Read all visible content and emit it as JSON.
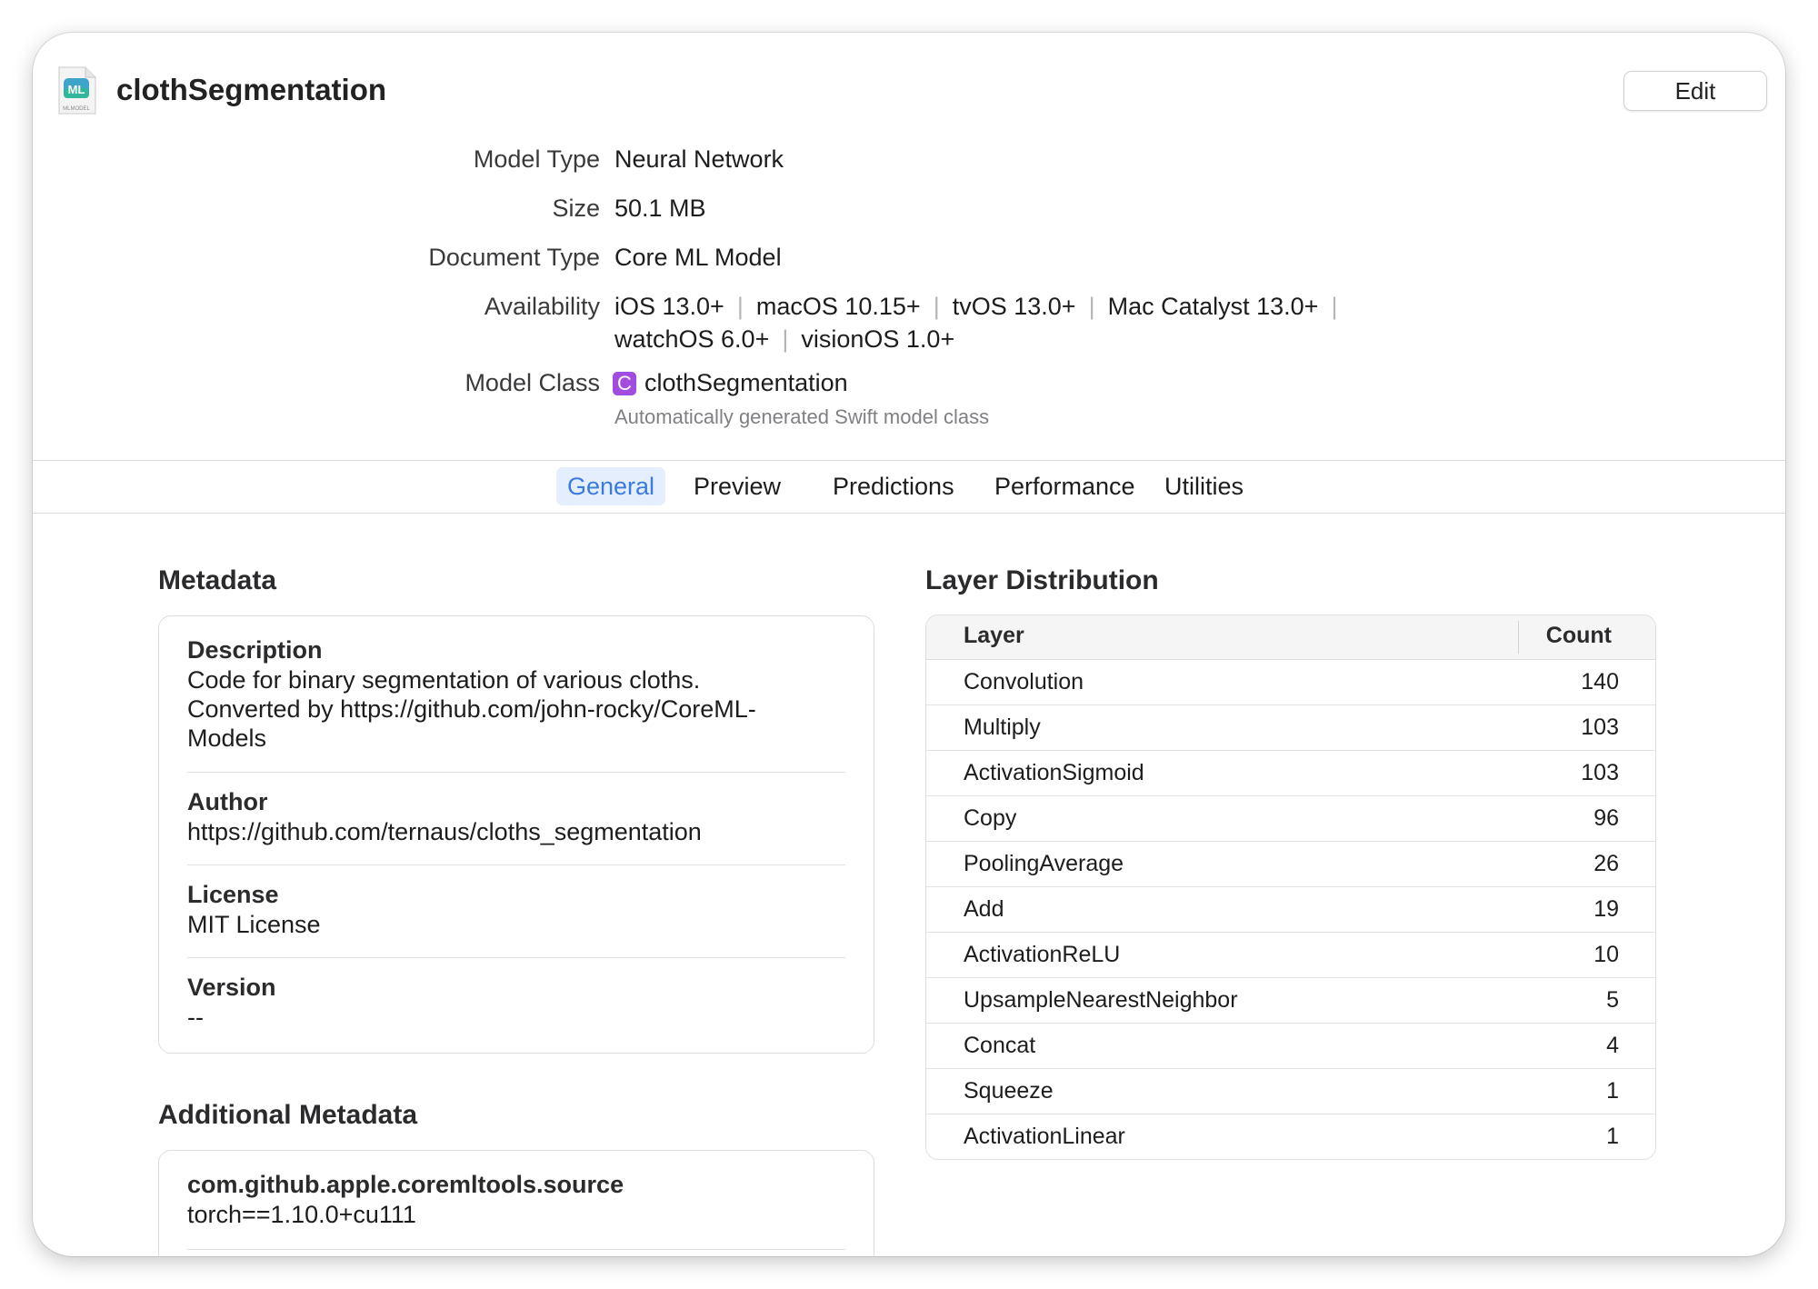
{
  "header": {
    "title": "clothSegmentation",
    "icon_caption": "MLMODEL",
    "edit_label": "Edit"
  },
  "info": {
    "model_type_label": "Model Type",
    "model_type": "Neural Network",
    "size_label": "Size",
    "size": "50.1 MB",
    "doc_type_label": "Document Type",
    "doc_type": "Core ML Model",
    "availability_label": "Availability",
    "availability": [
      "iOS 13.0+",
      "macOS 10.15+",
      "tvOS 13.0+",
      "Mac Catalyst 13.0+",
      "watchOS 6.0+",
      "visionOS 1.0+"
    ],
    "model_class_label": "Model Class",
    "model_class_badge": "C",
    "model_class": "clothSegmentation",
    "model_class_note": "Automatically generated Swift model class"
  },
  "tabs": [
    {
      "label": "General",
      "active": true
    },
    {
      "label": "Preview",
      "active": false
    },
    {
      "label": "Predictions",
      "active": false
    },
    {
      "label": "Performance",
      "active": false
    },
    {
      "label": "Utilities",
      "active": false
    }
  ],
  "metadata": {
    "title": "Metadata",
    "items": [
      {
        "key": "Description",
        "lines": [
          "Code for binary segmentation of various cloths.",
          "Converted by https://github.com/john-rocky/CoreML-",
          "Models"
        ]
      },
      {
        "key": "Author",
        "lines": [
          "https://github.com/ternaus/cloths_segmentation"
        ]
      },
      {
        "key": "License",
        "lines": [
          "MIT License"
        ]
      },
      {
        "key": "Version",
        "lines": [
          "--"
        ]
      }
    ]
  },
  "additional_metadata": {
    "title": "Additional Metadata",
    "items": [
      {
        "key": "com.github.apple.coremltools.source",
        "lines": [
          "torch==1.10.0+cu111"
        ]
      }
    ]
  },
  "layer_distribution": {
    "title": "Layer Distribution",
    "columns": [
      "Layer",
      "Count"
    ],
    "rows": [
      {
        "layer": "Convolution",
        "count": "140"
      },
      {
        "layer": "Multiply",
        "count": "103"
      },
      {
        "layer": "ActivationSigmoid",
        "count": "103"
      },
      {
        "layer": "Copy",
        "count": "96"
      },
      {
        "layer": "PoolingAverage",
        "count": "26"
      },
      {
        "layer": "Add",
        "count": "19"
      },
      {
        "layer": "ActivationReLU",
        "count": "10"
      },
      {
        "layer": "UpsampleNearestNeighbor",
        "count": "5"
      },
      {
        "layer": "Concat",
        "count": "4"
      },
      {
        "layer": "Squeeze",
        "count": "1"
      },
      {
        "layer": "ActivationLinear",
        "count": "1"
      }
    ]
  },
  "colors": {
    "accent": "#3b7ae0",
    "tab_active_bg": "#e5eefd",
    "class_badge": "#a24ce0"
  }
}
